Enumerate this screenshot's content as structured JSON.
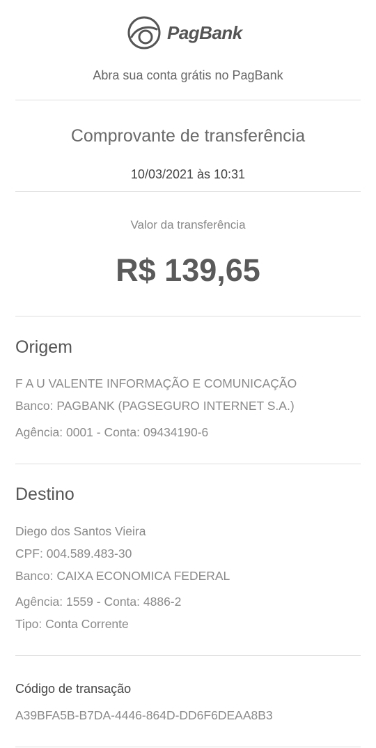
{
  "header": {
    "brand": "PagBank",
    "logo_icon": "pagbank-logo-icon",
    "signup_text": "Abra sua conta grátis no PagBank"
  },
  "receipt": {
    "title": "Comprovante de transferência",
    "datetime": "10/03/2021 às 10:31",
    "amount_label": "Valor da transferência",
    "amount": "R$ 139,65"
  },
  "origin": {
    "heading": "Origem",
    "name": "F A U VALENTE INFORMAÇÃO E COMUNICAÇÃO",
    "bank": "Banco: PAGBANK (PAGSEGURO INTERNET S.A.)",
    "account": "Agência: 0001 - Conta: 09434190-6"
  },
  "destination": {
    "heading": "Destino",
    "name": "Diego dos Santos Vieira",
    "cpf": "CPF: 004.589.483-30",
    "bank": "Banco: CAIXA ECONOMICA FEDERAL",
    "account": "Agência: 1559 - Conta: 4886-2",
    "type": "Tipo: Conta Corrente"
  },
  "transaction": {
    "label": "Código de transação",
    "code": "A39BFA5B-B7DA-4446-864D-DD6F6DEAA8B3"
  },
  "colors": {
    "text_primary": "#555555",
    "text_secondary": "#8a8a8a",
    "divider": "#dddddd",
    "background": "#ffffff"
  }
}
